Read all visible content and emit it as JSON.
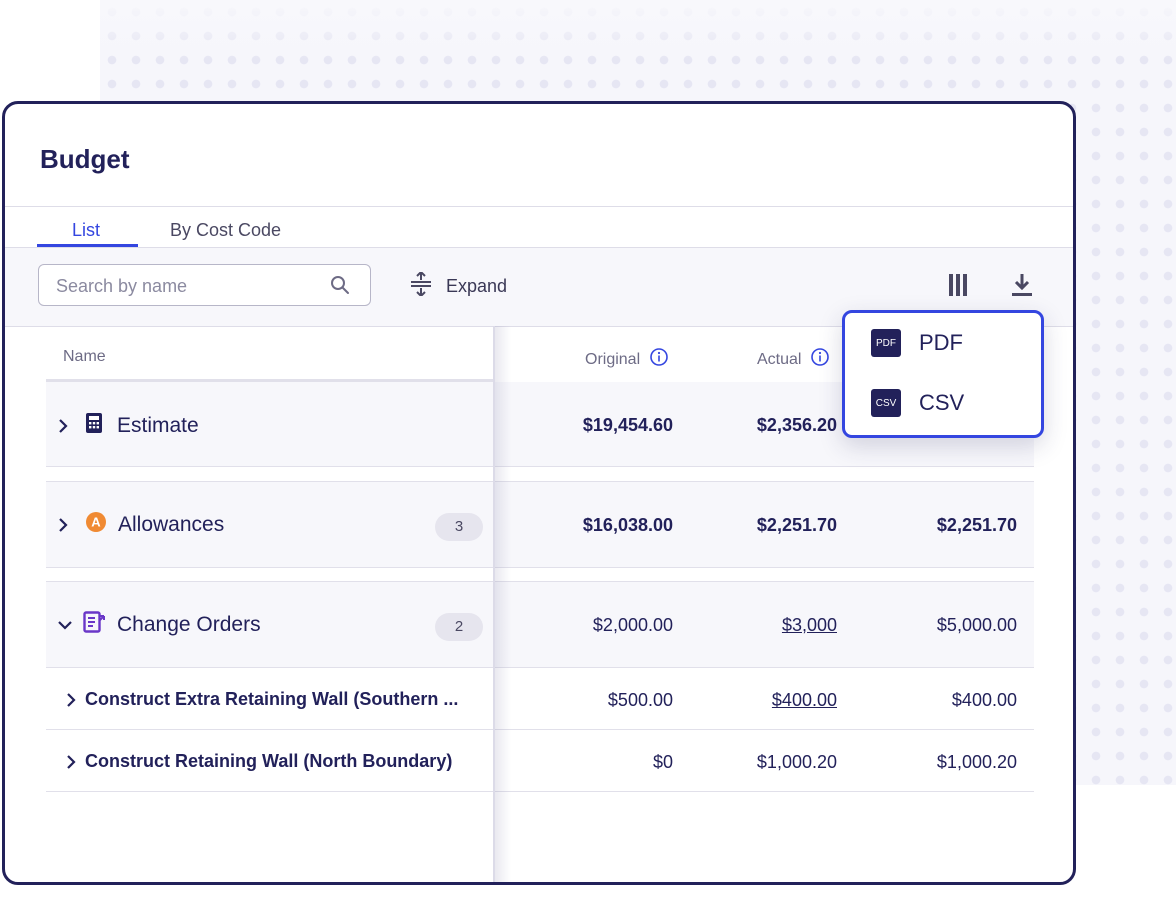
{
  "page": {
    "title": "Budget"
  },
  "tabs": [
    {
      "label": "List",
      "active": true
    },
    {
      "label": "By Cost Code",
      "active": false
    }
  ],
  "toolbar": {
    "search_placeholder": "Search by name",
    "expand_label": "Expand"
  },
  "columns": {
    "name": "Name",
    "original": "Original",
    "actual": "Actual"
  },
  "groups": [
    {
      "name": "Estimate",
      "icon": "calculator-icon",
      "badge": null,
      "original": "$19,454.60",
      "actual": "$2,356.20",
      "third": ""
    },
    {
      "name": "Allowances",
      "icon": "allowance-a-icon",
      "badge": "3",
      "original": "$16,038.00",
      "actual": "$2,251.70",
      "third": "$2,251.70"
    },
    {
      "name": "Change Orders",
      "icon": "change-order-icon",
      "badge": "2",
      "original": "$2,000.00",
      "actual": "$3,000",
      "third": "$5,000.00"
    }
  ],
  "subrows": [
    {
      "name": "Construct Extra Retaining Wall (Southern ...",
      "original": "$500.00",
      "actual": "$400.00",
      "third": "$400.00"
    },
    {
      "name": "Construct Retaining Wall (North Boundary)",
      "original": "$0",
      "actual": "$1,000.20",
      "third": "$1,000.20"
    }
  ],
  "export_menu": [
    {
      "label": "PDF",
      "icon_text": "PDF"
    },
    {
      "label": "CSV",
      "icon_text": "CSV"
    }
  ],
  "colors": {
    "accent": "#3446e0",
    "navy": "#22215a",
    "allowance_orange": "#f08a33",
    "change_order_purple": "#6a37c8"
  }
}
